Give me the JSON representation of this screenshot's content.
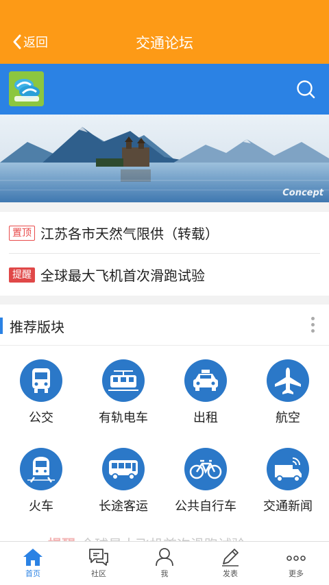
{
  "header": {
    "back_label": "返回",
    "title": "交通论坛",
    "background_color": "#fd9a16"
  },
  "toolbar": {
    "background_color": "#2b82e4",
    "logo_icon": "forum-logo",
    "search_icon": "search-icon"
  },
  "banner": {
    "caption": "Concept"
  },
  "notices": [
    {
      "tag": "置顶",
      "text": "江苏各市天然气限供（转载）"
    },
    {
      "tag": "提醒",
      "text": "全球最大飞机首次滑跑试验"
    }
  ],
  "recommended": {
    "title": "推荐版块",
    "boards": [
      {
        "label": "公交",
        "icon": "bus-icon"
      },
      {
        "label": "有轨电车",
        "icon": "tram-icon"
      },
      {
        "label": "出租",
        "icon": "taxi-icon"
      },
      {
        "label": "航空",
        "icon": "airplane-icon"
      },
      {
        "label": "火车",
        "icon": "train-icon"
      },
      {
        "label": "长途客运",
        "icon": "coach-icon"
      },
      {
        "label": "公共自行车",
        "icon": "bicycle-icon"
      },
      {
        "label": "交通新闻",
        "icon": "news-truck-icon"
      }
    ]
  },
  "tabbar": {
    "tabs": [
      {
        "label": "首页",
        "icon": "home-icon",
        "active": true
      },
      {
        "label": "社区",
        "icon": "chat-icon",
        "active": false
      },
      {
        "label": "我",
        "icon": "user-icon",
        "active": false
      },
      {
        "label": "发表",
        "icon": "pen-icon",
        "active": false
      },
      {
        "label": "更多",
        "icon": "more-icon",
        "active": false
      }
    ],
    "active_color": "#2b82e4"
  }
}
